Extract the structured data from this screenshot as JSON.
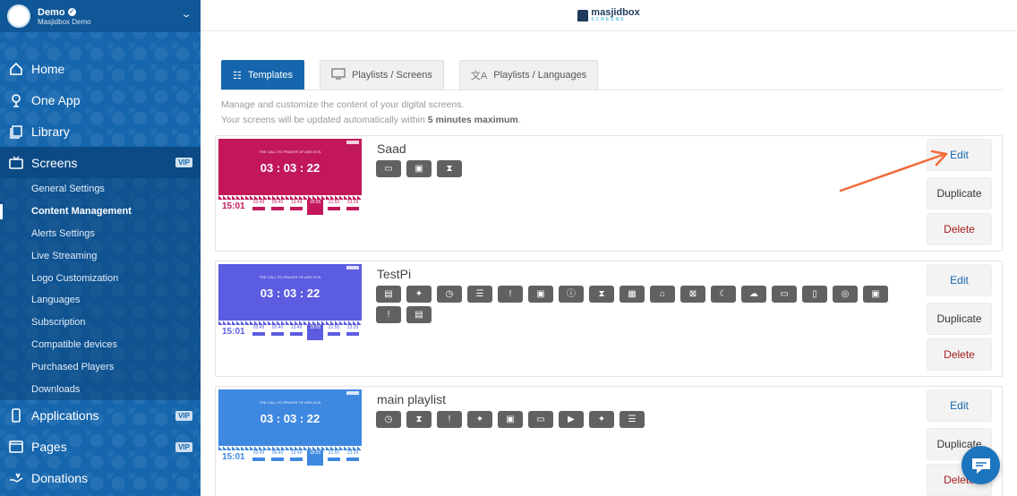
{
  "account": {
    "name": "Demo",
    "subtitle": "Masjidbox Demo"
  },
  "nav": {
    "home": "Home",
    "one_app": "One App",
    "library": "Library",
    "screens": "Screens",
    "screens_badge": "VIP",
    "screens_sub": [
      "General Settings",
      "Content Management",
      "Alerts Settings",
      "Live Streaming",
      "Logo Customization",
      "Languages",
      "Subscription",
      "Compatible devices",
      "Purchased Players",
      "Downloads"
    ],
    "applications": "Applications",
    "applications_badge": "VIP",
    "pages": "Pages",
    "pages_badge": "VIP",
    "donations": "Donations"
  },
  "brand": {
    "name": "masjidbox",
    "sub": "SCREENS"
  },
  "tabs": {
    "templates": "Templates",
    "playlists_screens": "Playlists / Screens",
    "playlists_languages": "Playlists / Languages"
  },
  "description": {
    "line1": "Manage and customize the content of your digital screens.",
    "line2_prefix": "Your screens will be updated automatically within ",
    "line2_bold": "5 minutes maximum",
    "line2_suffix": "."
  },
  "buttons": {
    "edit": "Edit",
    "duplicate": "Duplicate",
    "delete": "Delete"
  },
  "thumbnail": {
    "caption": "THE CALL TO PRAYER OF ASR IS IN",
    "countdown": "03 : 03 : 22",
    "clock": "15:01",
    "prayer_times": [
      "03:49",
      "05:40",
      "13:49",
      "18:05",
      "21:50",
      "23:29"
    ]
  },
  "templates": [
    {
      "name": "Saad",
      "color": "#c2185b",
      "icons": [
        "book-icon",
        "image-icon",
        "hourglass-icon"
      ]
    },
    {
      "name": "TestPi",
      "color": "#5c5ce0",
      "icons": [
        "calendar-icon",
        "magic-wand-icon",
        "clock-icon",
        "list-icon",
        "alert-icon",
        "image-icon",
        "info-icon",
        "hourglass-icon",
        "calendar-event-icon",
        "mosque-icon",
        "close-box-icon",
        "moon-icon",
        "cloud-icon",
        "book-icon",
        "book-open-icon",
        "target-icon",
        "image-icon",
        "alert-icon",
        "calendar-icon"
      ]
    },
    {
      "name": "main playlist",
      "color": "#3f88e0",
      "icons": [
        "clock-icon",
        "hourglass-icon",
        "alert-icon",
        "magic-wand-icon",
        "image-icon",
        "book-icon",
        "play-box-icon",
        "magic-wand-icon",
        "list-icon"
      ]
    }
  ],
  "colors": {
    "sidebar": "#1566ad",
    "accent": "#1566ad",
    "delete": "#a31d1d",
    "arrow": "#f26b3a"
  }
}
